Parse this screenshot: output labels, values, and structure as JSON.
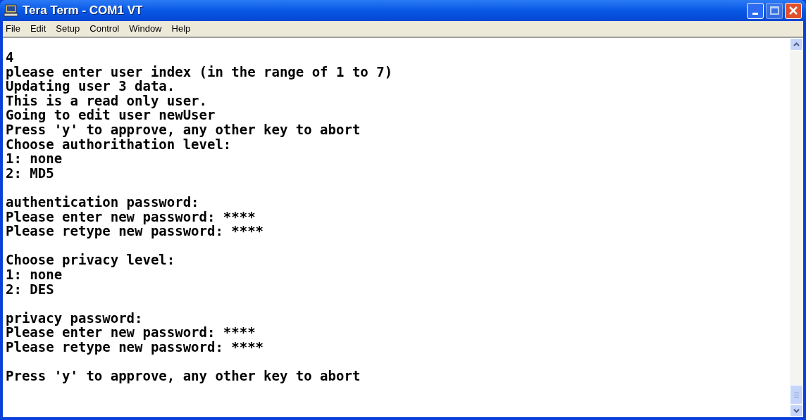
{
  "window": {
    "title": "Tera Term - COM1 VT"
  },
  "menu": [
    "File",
    "Edit",
    "Setup",
    "Control",
    "Window",
    "Help"
  ],
  "terminal": {
    "blocks": [
      [
        "4",
        "please enter user index (in the range of 1 to 7)",
        "Updating user 3 data.",
        "This is a read only user.",
        "Going to edit user newUser",
        "Press 'y' to approve, any other key to abort",
        "Choose authorithation level:",
        "1: none",
        "2: MD5"
      ],
      [
        "authentication password:",
        "Please enter new password: ****",
        "Please retype new password: ****"
      ],
      [
        "Choose privacy level:",
        "1: none",
        "2: DES"
      ],
      [
        "privacy password:",
        "Please enter new password: ****",
        "Please retype new password: ****"
      ],
      [
        "Press 'y' to approve, any other key to abort"
      ]
    ]
  }
}
